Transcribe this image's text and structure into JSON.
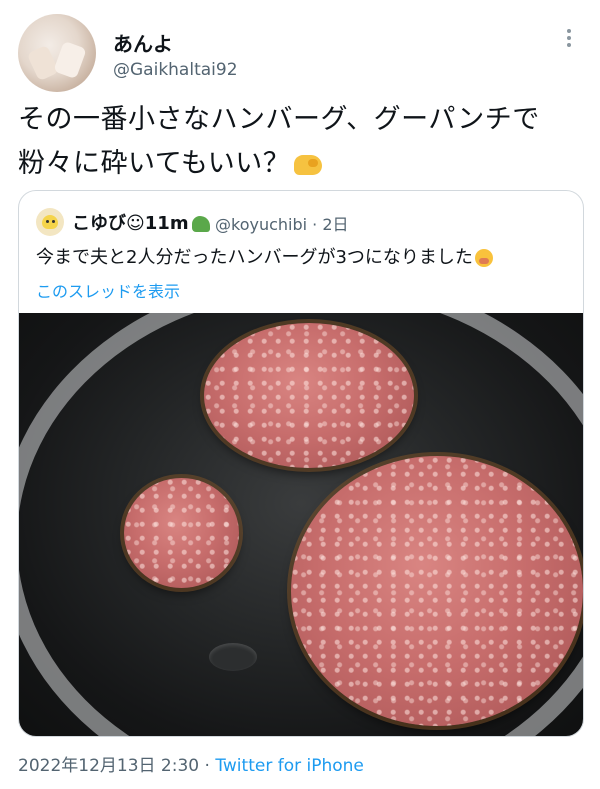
{
  "author": {
    "display_name": "あんよ",
    "handle": "@Gaikhaltai92"
  },
  "tweet": {
    "text": "その一番小さなハンバーグ、グーパンチで粉々に砕いてもいい？",
    "emoji": "fist-emoji"
  },
  "quoted": {
    "display_name": "こゆび☺11m",
    "handle_date": "@koyuchibi · 2日",
    "text": "今まで夫と2人分だったハンバーグが3つになりました",
    "thread_link": "このスレッドを表示",
    "photo": {
      "items": [
        "large hamburger patty",
        "medium hamburger patty",
        "small hamburger patty",
        "frying pan"
      ]
    }
  },
  "footer": {
    "timestamp": "2022年12月13日 2:30",
    "separator": "·",
    "source": "Twitter for iPhone"
  },
  "colors": {
    "link": "#1d9bf0",
    "secondary_text": "#536471",
    "border": "#d2d8dd"
  }
}
